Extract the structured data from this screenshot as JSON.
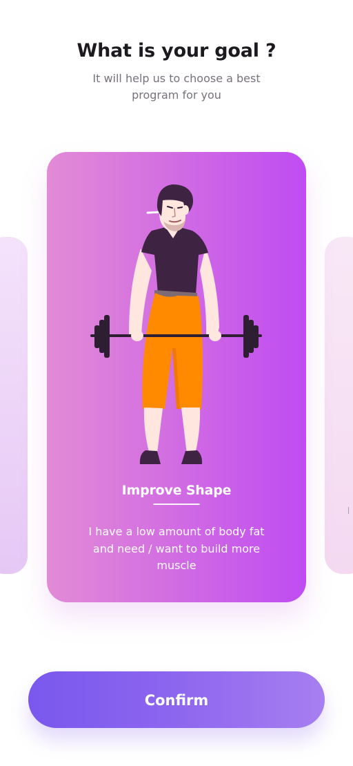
{
  "header": {
    "title": "What is your goal ?",
    "subtitle": "It will help us to choose a best program for you"
  },
  "carousel": {
    "current": {
      "title": "Improve Shape",
      "description": "I have a low amount of body fat and need / want to build more muscle",
      "illustration": "man-lifting-barbell-illustration"
    }
  },
  "actions": {
    "confirm_label": "Confirm"
  },
  "colors": {
    "card_gradient_start": "#e28bd6",
    "card_gradient_end": "#bf4cf2",
    "button_gradient_start": "#7a58ee",
    "button_gradient_end": "#a77ff0",
    "pants": "#ff8a00",
    "shirt": "#3e2342",
    "skin": "#ffe6df",
    "equipment": "#2d1e31"
  }
}
